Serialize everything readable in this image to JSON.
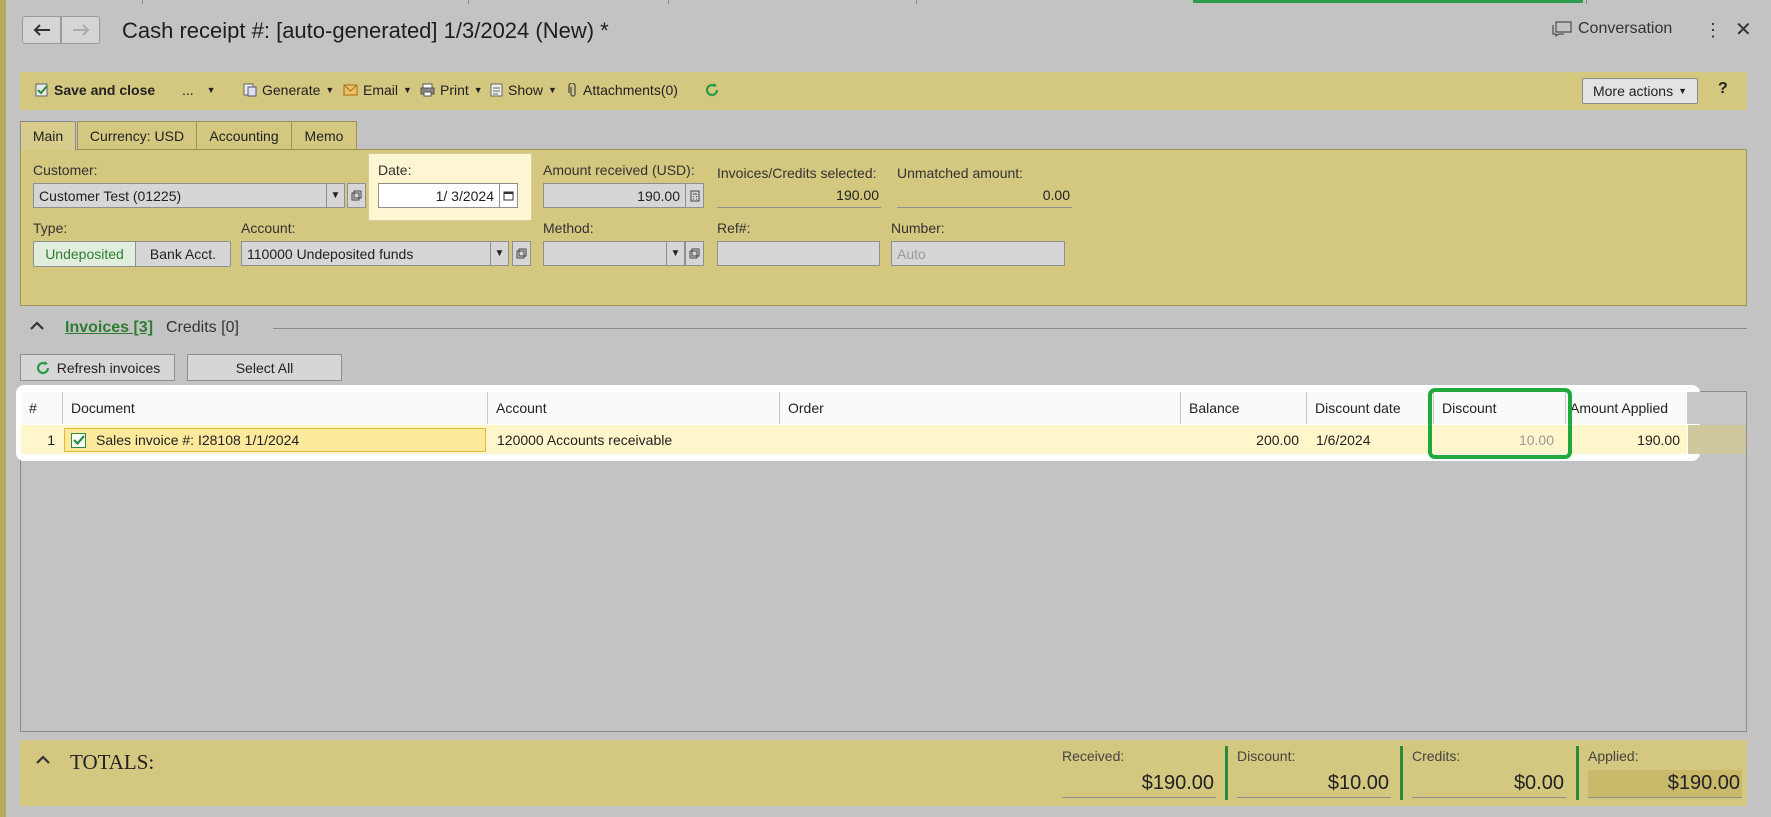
{
  "header": {
    "title": "Cash receipt #: [auto-generated] 1/3/2024 (New) *",
    "conversation_label": "Conversation"
  },
  "toolbar": {
    "save_close": "Save and close",
    "ellipsis": "...",
    "generate": "Generate",
    "email": "Email",
    "print": "Print",
    "show": "Show",
    "attachments": "Attachments(0)",
    "more_actions": "More actions",
    "help": "?"
  },
  "tabs": [
    "Main",
    "Currency: USD",
    "Accounting",
    "Memo"
  ],
  "form": {
    "customer_label": "Customer:",
    "customer_value": "Customer Test (01225)",
    "date_label": "Date:",
    "date_value": "1/ 3/2024",
    "amount_received_label": "Amount received (USD):",
    "amount_received_value": "190.00",
    "invoices_selected_label": "Invoices/Credits selected:",
    "invoices_selected_value": "190.00",
    "unmatched_label": "Unmatched amount:",
    "unmatched_value": "0.00",
    "type_label": "Type:",
    "type_options": [
      "Undeposited",
      "Bank Acct."
    ],
    "type_selected": "Undeposited",
    "account_label": "Account:",
    "account_value": "110000 Undeposited funds",
    "method_label": "Method:",
    "method_value": "",
    "ref_label": "Ref#:",
    "ref_value": "",
    "number_label": "Number:",
    "number_placeholder": "Auto"
  },
  "section": {
    "invoices_label": "Invoices [3]",
    "credits_label": "Credits [0]",
    "refresh_button": "Refresh invoices",
    "select_all_button": "Select All"
  },
  "grid": {
    "columns": [
      "#",
      "Document",
      "Account",
      "Order",
      "Balance",
      "Discount date",
      "Discount",
      "Amount Applied"
    ],
    "rows": [
      {
        "num": "1",
        "checked": true,
        "document": "Sales invoice #: I28108 1/1/2024",
        "account": "120000 Accounts receivable",
        "order": "",
        "balance": "200.00",
        "discount_date": "1/6/2024",
        "discount": "10.00",
        "amount_applied": "190.00"
      }
    ]
  },
  "totals": {
    "title": "TOTALS:",
    "received_label": "Received:",
    "received_value": "$190.00",
    "discount_label": "Discount:",
    "discount_value": "$10.00",
    "credits_label": "Credits:",
    "credits_value": "$0.00",
    "applied_label": "Applied:",
    "applied_value": "$190.00"
  },
  "colors": {
    "toolbar_bg": "#d4c77f",
    "accent_green": "#2e7d32",
    "highlight_box": "#1faa3b",
    "row_bg": "#fff6cc"
  }
}
